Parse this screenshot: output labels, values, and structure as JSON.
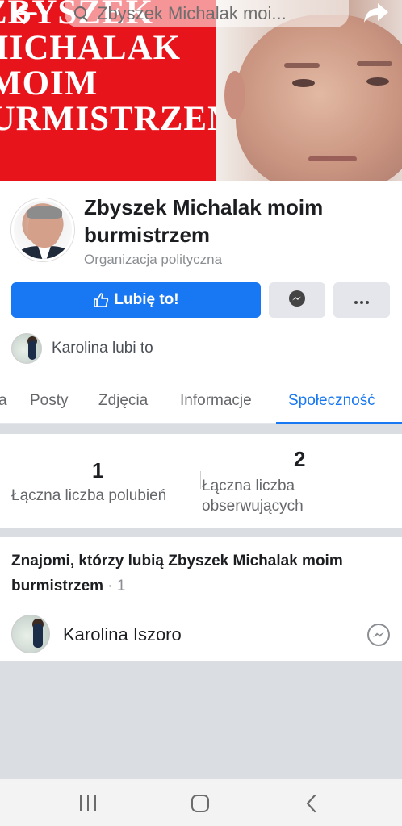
{
  "cover": {
    "banner_lines": [
      "ZBYSZEK",
      "MICHALAK",
      "MOIM",
      "BURMISTRZEM"
    ]
  },
  "topbar": {
    "search_text": "Zbyszek Michalak moi...",
    "back_icon": "back-arrow-icon",
    "share_icon": "share-icon"
  },
  "profile": {
    "name": "Zbyszek Michalak moim burmistrzem",
    "category": "Organizacja polityczna",
    "like_button_label": "Lubię to!",
    "friend_like_text": "Karolina lubi to"
  },
  "tabs": {
    "items": [
      {
        "label": "a"
      },
      {
        "label": "Posty"
      },
      {
        "label": "Zdjęcia"
      },
      {
        "label": "Informacje"
      },
      {
        "label": "Społeczność"
      }
    ],
    "active": "Społeczność"
  },
  "stats": {
    "likes_count": "1",
    "likes_label": "Łączna liczba polubień",
    "followers_count": "2",
    "followers_label_line1": "Łączna liczba",
    "followers_label_line2": "obserwujących"
  },
  "friends": {
    "title": "Znajomi, którzy lubią Zbyszek Michalak moim burmistrzem",
    "count": " · 1",
    "items": [
      {
        "name": "Karolina Iszoro"
      }
    ]
  },
  "colors": {
    "brand": "#1877f2",
    "cover_red": "#e8141b"
  }
}
